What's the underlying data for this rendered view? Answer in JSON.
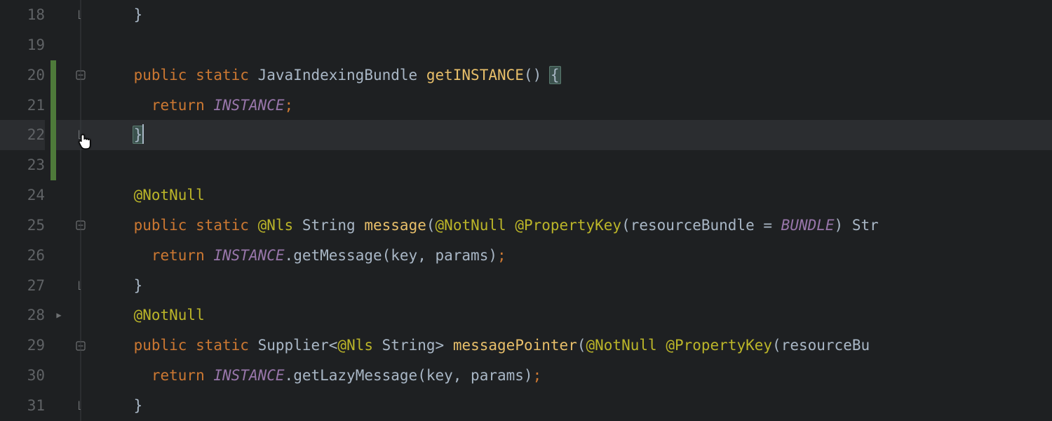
{
  "lines": {
    "n18": "18",
    "n19": "19",
    "n20": "20",
    "n21": "21",
    "n22": "22",
    "n23": "23",
    "n24": "24",
    "n25": "25",
    "n26": "26",
    "n27": "27",
    "n28": "28",
    "n29": "29",
    "n30": "30",
    "n31": "31"
  },
  "code": {
    "l18": {
      "indent": "    ",
      "brace": "}"
    },
    "l20": {
      "indent": "    ",
      "kw1": "public",
      "sp1": " ",
      "kw2": "static",
      "sp2": " ",
      "type": "JavaIndexingBundle",
      "sp3": " ",
      "method": "getINSTANCE",
      "paren": "()",
      "sp4": " ",
      "brace": "{"
    },
    "l21": {
      "indent": "      ",
      "kw": "return",
      "sp": " ",
      "field": "INSTANCE",
      "semi": ";"
    },
    "l22": {
      "indent": "    ",
      "brace": "}"
    },
    "l24": {
      "indent": "    ",
      "anno": "@NotNull"
    },
    "l25": {
      "indent": "    ",
      "kw1": "public",
      "sp1": " ",
      "kw2": "static",
      "sp2": " ",
      "anno1": "@Nls",
      "sp3": " ",
      "type1": "String",
      "sp4": " ",
      "method": "message",
      "paren_o": "(",
      "anno2": "@NotNull",
      "sp5": " ",
      "anno3": "@PropertyKey",
      "paren_o2": "(",
      "param": "resourceBundle",
      "sp6": " = ",
      "field": "BUNDLE",
      "paren_c2": ")",
      "sp7": " ",
      "type2": "Str"
    },
    "l26": {
      "indent": "      ",
      "kw": "return",
      "sp1": " ",
      "field": "INSTANCE",
      "dot": ".",
      "method": "getMessage",
      "args": "(key, params)",
      "semi": ";"
    },
    "l27": {
      "indent": "    ",
      "brace": "}"
    },
    "l28": {
      "indent": "    ",
      "anno": "@NotNull"
    },
    "l29": {
      "indent": "    ",
      "kw1": "public",
      "sp1": " ",
      "kw2": "static",
      "sp2": " ",
      "type1": "Supplier",
      "lt": "<",
      "anno1": "@Nls",
      "sp3": " ",
      "type2": "String",
      "gt": ">",
      "sp4": " ",
      "method": "messagePointer",
      "paren_o": "(",
      "anno2": "@NotNull",
      "sp5": " ",
      "anno3": "@PropertyKey",
      "paren_o2": "(",
      "param": "resourceBu"
    },
    "l30": {
      "indent": "      ",
      "kw": "return",
      "sp1": " ",
      "field": "INSTANCE",
      "dot": ".",
      "method": "getLazyMessage",
      "args": "(key, params)",
      "semi": ";"
    },
    "l31": {
      "indent": "    ",
      "brace": "}"
    }
  }
}
